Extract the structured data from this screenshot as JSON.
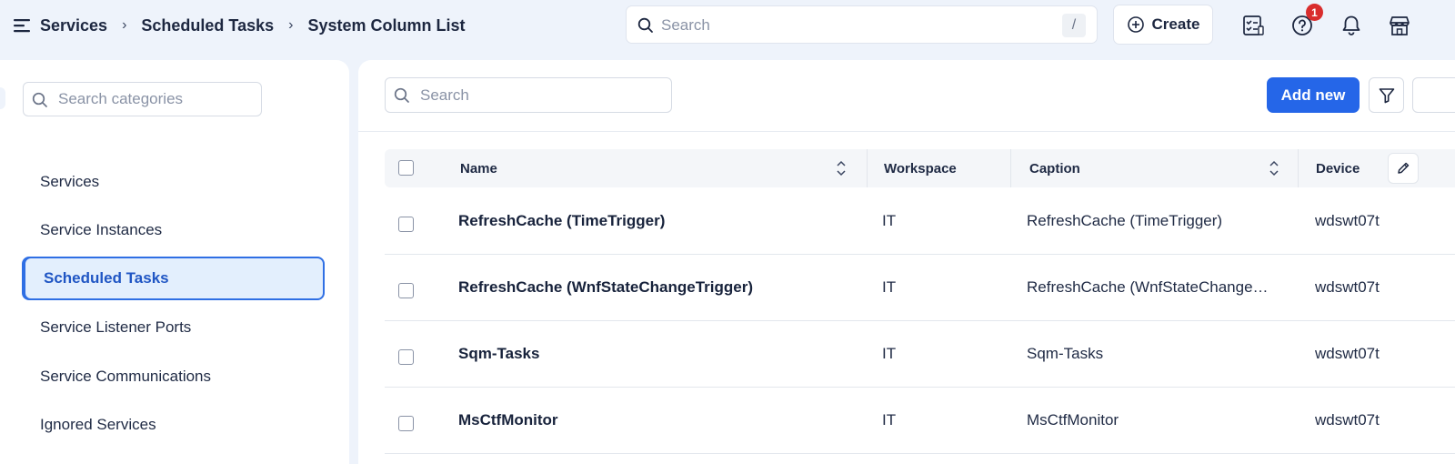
{
  "breadcrumb": [
    "Services",
    "Scheduled Tasks",
    "System Column List"
  ],
  "global_search": {
    "placeholder": "Search",
    "shortcut": "/"
  },
  "create_label": "Create",
  "notifications": {
    "help_badge": "1"
  },
  "categories": {
    "search_placeholder": "Search categories",
    "items": [
      "Services",
      "Service Instances",
      "Scheduled Tasks",
      "Service Listener Ports",
      "Service Communications",
      "Ignored Services"
    ],
    "active": "Scheduled Tasks"
  },
  "list": {
    "search_placeholder": "Search",
    "add_label": "Add new",
    "columns": [
      "Name",
      "Workspace",
      "Caption",
      "Device"
    ],
    "rows": [
      {
        "name": "RefreshCache (TimeTrigger)",
        "workspace": "IT",
        "caption": "RefreshCache (TimeTrigger)",
        "device": "wdswt07t"
      },
      {
        "name": "RefreshCache (WnfStateChangeTrigger)",
        "workspace": "IT",
        "caption": "RefreshCache (WnfStateChange…",
        "device": "wdswt07t"
      },
      {
        "name": "Sqm-Tasks",
        "workspace": "IT",
        "caption": "Sqm-Tasks",
        "device": "wdswt07t"
      },
      {
        "name": "MsCtfMonitor",
        "workspace": "IT",
        "caption": "MsCtfMonitor",
        "device": "wdswt07t"
      }
    ]
  },
  "colors": {
    "accent": "#2566e8",
    "active_bg": "#e3effd",
    "badge": "#d92d2d",
    "page_bg": "#eef3fb"
  }
}
